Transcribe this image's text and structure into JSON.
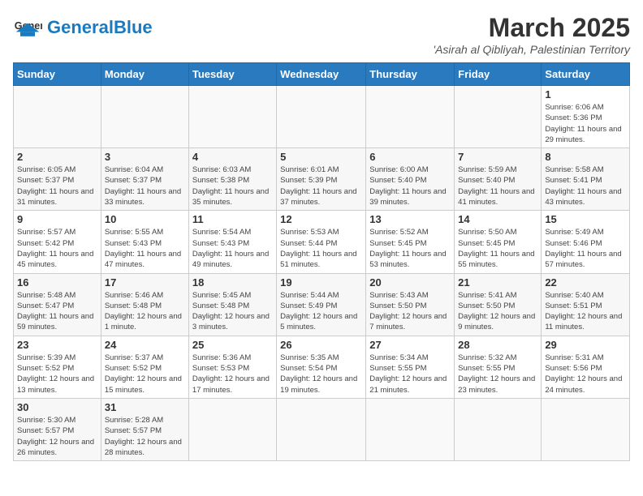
{
  "header": {
    "logo_general": "General",
    "logo_blue": "Blue",
    "month": "March 2025",
    "location": "'Asirah al Qibliyah, Palestinian Territory"
  },
  "weekdays": [
    "Sunday",
    "Monday",
    "Tuesday",
    "Wednesday",
    "Thursday",
    "Friday",
    "Saturday"
  ],
  "weeks": [
    [
      {
        "day": "",
        "info": ""
      },
      {
        "day": "",
        "info": ""
      },
      {
        "day": "",
        "info": ""
      },
      {
        "day": "",
        "info": ""
      },
      {
        "day": "",
        "info": ""
      },
      {
        "day": "",
        "info": ""
      },
      {
        "day": "1",
        "info": "Sunrise: 6:06 AM\nSunset: 5:36 PM\nDaylight: 11 hours and 29 minutes."
      }
    ],
    [
      {
        "day": "2",
        "info": "Sunrise: 6:05 AM\nSunset: 5:37 PM\nDaylight: 11 hours and 31 minutes."
      },
      {
        "day": "3",
        "info": "Sunrise: 6:04 AM\nSunset: 5:37 PM\nDaylight: 11 hours and 33 minutes."
      },
      {
        "day": "4",
        "info": "Sunrise: 6:03 AM\nSunset: 5:38 PM\nDaylight: 11 hours and 35 minutes."
      },
      {
        "day": "5",
        "info": "Sunrise: 6:01 AM\nSunset: 5:39 PM\nDaylight: 11 hours and 37 minutes."
      },
      {
        "day": "6",
        "info": "Sunrise: 6:00 AM\nSunset: 5:40 PM\nDaylight: 11 hours and 39 minutes."
      },
      {
        "day": "7",
        "info": "Sunrise: 5:59 AM\nSunset: 5:40 PM\nDaylight: 11 hours and 41 minutes."
      },
      {
        "day": "8",
        "info": "Sunrise: 5:58 AM\nSunset: 5:41 PM\nDaylight: 11 hours and 43 minutes."
      }
    ],
    [
      {
        "day": "9",
        "info": "Sunrise: 5:57 AM\nSunset: 5:42 PM\nDaylight: 11 hours and 45 minutes."
      },
      {
        "day": "10",
        "info": "Sunrise: 5:55 AM\nSunset: 5:43 PM\nDaylight: 11 hours and 47 minutes."
      },
      {
        "day": "11",
        "info": "Sunrise: 5:54 AM\nSunset: 5:43 PM\nDaylight: 11 hours and 49 minutes."
      },
      {
        "day": "12",
        "info": "Sunrise: 5:53 AM\nSunset: 5:44 PM\nDaylight: 11 hours and 51 minutes."
      },
      {
        "day": "13",
        "info": "Sunrise: 5:52 AM\nSunset: 5:45 PM\nDaylight: 11 hours and 53 minutes."
      },
      {
        "day": "14",
        "info": "Sunrise: 5:50 AM\nSunset: 5:45 PM\nDaylight: 11 hours and 55 minutes."
      },
      {
        "day": "15",
        "info": "Sunrise: 5:49 AM\nSunset: 5:46 PM\nDaylight: 11 hours and 57 minutes."
      }
    ],
    [
      {
        "day": "16",
        "info": "Sunrise: 5:48 AM\nSunset: 5:47 PM\nDaylight: 11 hours and 59 minutes."
      },
      {
        "day": "17",
        "info": "Sunrise: 5:46 AM\nSunset: 5:48 PM\nDaylight: 12 hours and 1 minute."
      },
      {
        "day": "18",
        "info": "Sunrise: 5:45 AM\nSunset: 5:48 PM\nDaylight: 12 hours and 3 minutes."
      },
      {
        "day": "19",
        "info": "Sunrise: 5:44 AM\nSunset: 5:49 PM\nDaylight: 12 hours and 5 minutes."
      },
      {
        "day": "20",
        "info": "Sunrise: 5:43 AM\nSunset: 5:50 PM\nDaylight: 12 hours and 7 minutes."
      },
      {
        "day": "21",
        "info": "Sunrise: 5:41 AM\nSunset: 5:50 PM\nDaylight: 12 hours and 9 minutes."
      },
      {
        "day": "22",
        "info": "Sunrise: 5:40 AM\nSunset: 5:51 PM\nDaylight: 12 hours and 11 minutes."
      }
    ],
    [
      {
        "day": "23",
        "info": "Sunrise: 5:39 AM\nSunset: 5:52 PM\nDaylight: 12 hours and 13 minutes."
      },
      {
        "day": "24",
        "info": "Sunrise: 5:37 AM\nSunset: 5:52 PM\nDaylight: 12 hours and 15 minutes."
      },
      {
        "day": "25",
        "info": "Sunrise: 5:36 AM\nSunset: 5:53 PM\nDaylight: 12 hours and 17 minutes."
      },
      {
        "day": "26",
        "info": "Sunrise: 5:35 AM\nSunset: 5:54 PM\nDaylight: 12 hours and 19 minutes."
      },
      {
        "day": "27",
        "info": "Sunrise: 5:34 AM\nSunset: 5:55 PM\nDaylight: 12 hours and 21 minutes."
      },
      {
        "day": "28",
        "info": "Sunrise: 5:32 AM\nSunset: 5:55 PM\nDaylight: 12 hours and 23 minutes."
      },
      {
        "day": "29",
        "info": "Sunrise: 5:31 AM\nSunset: 5:56 PM\nDaylight: 12 hours and 24 minutes."
      }
    ],
    [
      {
        "day": "30",
        "info": "Sunrise: 5:30 AM\nSunset: 5:57 PM\nDaylight: 12 hours and 26 minutes."
      },
      {
        "day": "31",
        "info": "Sunrise: 5:28 AM\nSunset: 5:57 PM\nDaylight: 12 hours and 28 minutes."
      },
      {
        "day": "",
        "info": ""
      },
      {
        "day": "",
        "info": ""
      },
      {
        "day": "",
        "info": ""
      },
      {
        "day": "",
        "info": ""
      },
      {
        "day": "",
        "info": ""
      }
    ]
  ]
}
